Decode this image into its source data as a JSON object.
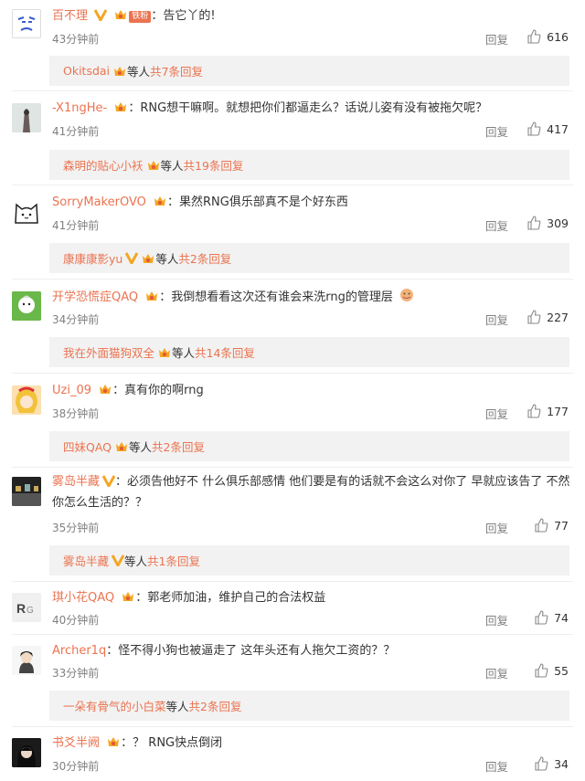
{
  "comments": [
    {
      "user": "百不理",
      "text": "：告它丫的!",
      "time": "43分钟前",
      "reply": "回复",
      "likes": "616",
      "fan_tag": "铁粉",
      "sub": {
        "name": "Okitsdai",
        "mid": " 等人 ",
        "count": "共7条回复"
      }
    },
    {
      "user": "-X1ngHe-",
      "text": "：RNG想干嘛啊。就想把你们都逼走么？话说儿姿有没有被拖欠呢？",
      "time": "41分钟前",
      "reply": "回复",
      "likes": "417",
      "sub": {
        "name": "森明的贴心小袄",
        "mid": " 等人 ",
        "count": "共19条回复"
      }
    },
    {
      "user": "SorryMakerOVO",
      "text": "：果然RNG俱乐部真不是个好东西",
      "time": "41分钟前",
      "reply": "回复",
      "likes": "309",
      "sub": {
        "name": "康康康影yu",
        "mid": " 等人 ",
        "count": "共2条回复"
      }
    },
    {
      "user": "开学恐慌症QAQ",
      "text": "：我倒想看看这次还有谁会来洗rng的管理层",
      "time": "34分钟前",
      "reply": "回复",
      "likes": "227",
      "sub": {
        "name": "我在外面猫狗双全",
        "mid": " 等人 ",
        "count": "共14条回复"
      }
    },
    {
      "user": "Uzi_09",
      "text": "：真有你的啊rng",
      "time": "38分钟前",
      "reply": "回复",
      "likes": "177",
      "sub": {
        "name": "四妹QAQ",
        "mid": " 等人 ",
        "count": "共2条回复"
      }
    },
    {
      "user": "雾岛半藏",
      "text": "：必须告他好不 什么俱乐部感情 他们要是有的话就不会这么对你了 早就应该告了 不然你怎么生活的？？",
      "time": "35分钟前",
      "reply": "回复",
      "likes": "77",
      "sub": {
        "name": "雾岛半藏",
        "mid": " 等人 ",
        "count": "共1条回复"
      }
    },
    {
      "user": "琪小花QAQ",
      "text": "：郭老师加油，维护自己的合法权益",
      "time": "40分钟前",
      "reply": "回复",
      "likes": "74"
    },
    {
      "user": "Archer1q",
      "text": "：怪不得小狗也被逼走了 这年头还有人拖欠工资的？？",
      "time": "33分钟前",
      "reply": "回复",
      "likes": "55",
      "sub": {
        "name": "一朵有骨气的小白菜",
        "mid": " 等人 ",
        "count": "共2条回复"
      }
    },
    {
      "user": "书爻半阙",
      "text": "：？ RNG快点倒闭",
      "time": "30分钟前",
      "reply": "回复",
      "likes": "34"
    }
  ],
  "colors": {
    "accent": "#eb7350",
    "muted": "#808080",
    "subbox_bg": "#f2f2f2"
  }
}
